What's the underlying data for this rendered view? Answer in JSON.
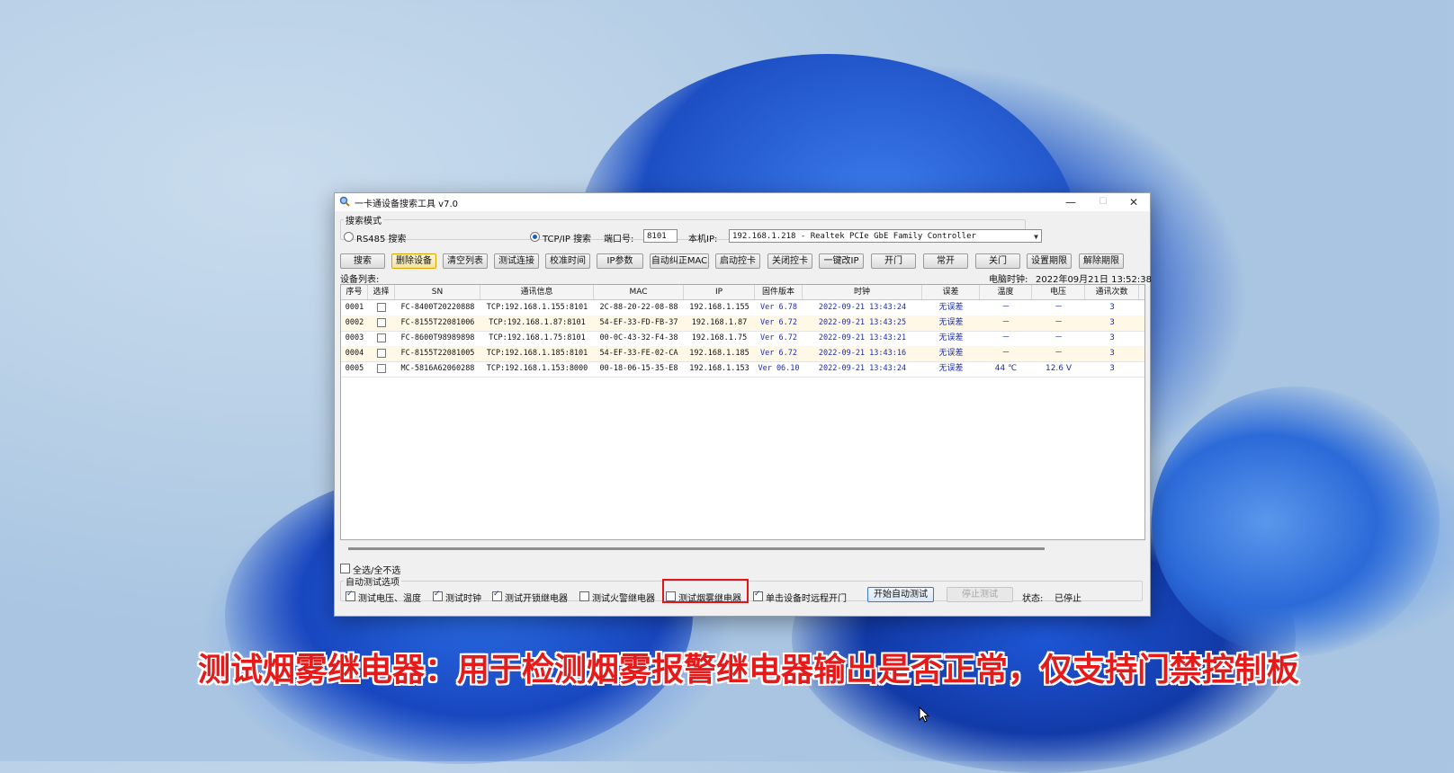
{
  "window": {
    "title": "一卡通设备搜索工具 v7.0",
    "controls": {
      "minimize": "—",
      "maximize": "☐",
      "close": "✕"
    }
  },
  "search_mode": {
    "legend": "搜索模式",
    "rs485_label": "RS485 搜索",
    "tcpip_label": "TCP/IP 搜索",
    "port_label": "端口号:",
    "port_value": "8101",
    "local_ip_label": "本机IP:",
    "local_ip_value": "192.168.1.218 - Realtek PCIe GbE Family Controller"
  },
  "toolbar": [
    "搜索",
    "删除设备",
    "清空列表",
    "测试连接",
    "校准时间",
    "IP参数",
    "自动纠正MAC",
    "启动控卡",
    "关闭控卡",
    "一键改IP",
    "开门",
    "常开",
    "关门",
    "设置期限",
    "解除期限"
  ],
  "device_list": {
    "label": "设备列表:",
    "clock_label": "电脑时钟:",
    "clock_value": "2022年09月21日 13:52:38",
    "columns": [
      "序号",
      "选择",
      "SN",
      "通讯信息",
      "MAC",
      "IP",
      "固件版本",
      "时钟",
      "误差",
      "温度",
      "电压",
      "通讯次数"
    ],
    "rows": [
      {
        "no": "0001",
        "sn": "FC-8400T20220888",
        "comm": "TCP:192.168.1.155:8101",
        "mac": "2C-88-20-22-08-88",
        "ip": "192.168.1.155",
        "fw": "Ver  6.78",
        "clock": "2022-09-21  13:43:24",
        "err": "无误差",
        "temp": "－",
        "volt": "－",
        "count": "3"
      },
      {
        "no": "0002",
        "sn": "FC-8155T22081006",
        "comm": "TCP:192.168.1.87:8101",
        "mac": "54-EF-33-FD-FB-37",
        "ip": "192.168.1.87",
        "fw": "Ver  6.72",
        "clock": "2022-09-21  13:43:25",
        "err": "无误差",
        "temp": "－",
        "volt": "－",
        "count": "3"
      },
      {
        "no": "0003",
        "sn": "FC-8600T98989898",
        "comm": "TCP:192.168.1.75:8101",
        "mac": "00-0C-43-32-F4-38",
        "ip": "192.168.1.75",
        "fw": "Ver  6.72",
        "clock": "2022-09-21  13:43:21",
        "err": "无误差",
        "temp": "－",
        "volt": "－",
        "count": "3"
      },
      {
        "no": "0004",
        "sn": "FC-8155T22081005",
        "comm": "TCP:192.168.1.185:8101",
        "mac": "54-EF-33-FE-02-CA",
        "ip": "192.168.1.185",
        "fw": "Ver  6.72",
        "clock": "2022-09-21  13:43:16",
        "err": "无误差",
        "temp": "－",
        "volt": "－",
        "count": "3"
      },
      {
        "no": "0005",
        "sn": "MC-5816A62060288",
        "comm": "TCP:192.168.1.153:8000",
        "mac": "00-18-06-15-35-E8",
        "ip": "192.168.1.153",
        "fw": "Ver 06.10",
        "clock": "2022-09-21  13:43:24",
        "err": "无误差",
        "temp": "44 ℃",
        "volt": "12.6 V",
        "count": "3"
      }
    ]
  },
  "select_all_label": "全选/全不选",
  "auto_test": {
    "legend": "自动测试选项",
    "options": [
      "测试电压、温度",
      "测试时钟",
      "测试开锁继电器",
      "测试火警继电器",
      "测试烟雾继电器",
      "单击设备时远程开门"
    ],
    "start_button": "开始自动测试",
    "stop_button": "停止测试",
    "status_label": "状态:",
    "status_value": "已停止"
  },
  "caption": "测试烟雾继电器：用于检测烟雾报警继电器输出是否正常，仅支持门禁控制板",
  "colors": {
    "highlight": "#e0161c",
    "caption": "#e31b1b",
    "accent_text": "#1d2fa8"
  }
}
